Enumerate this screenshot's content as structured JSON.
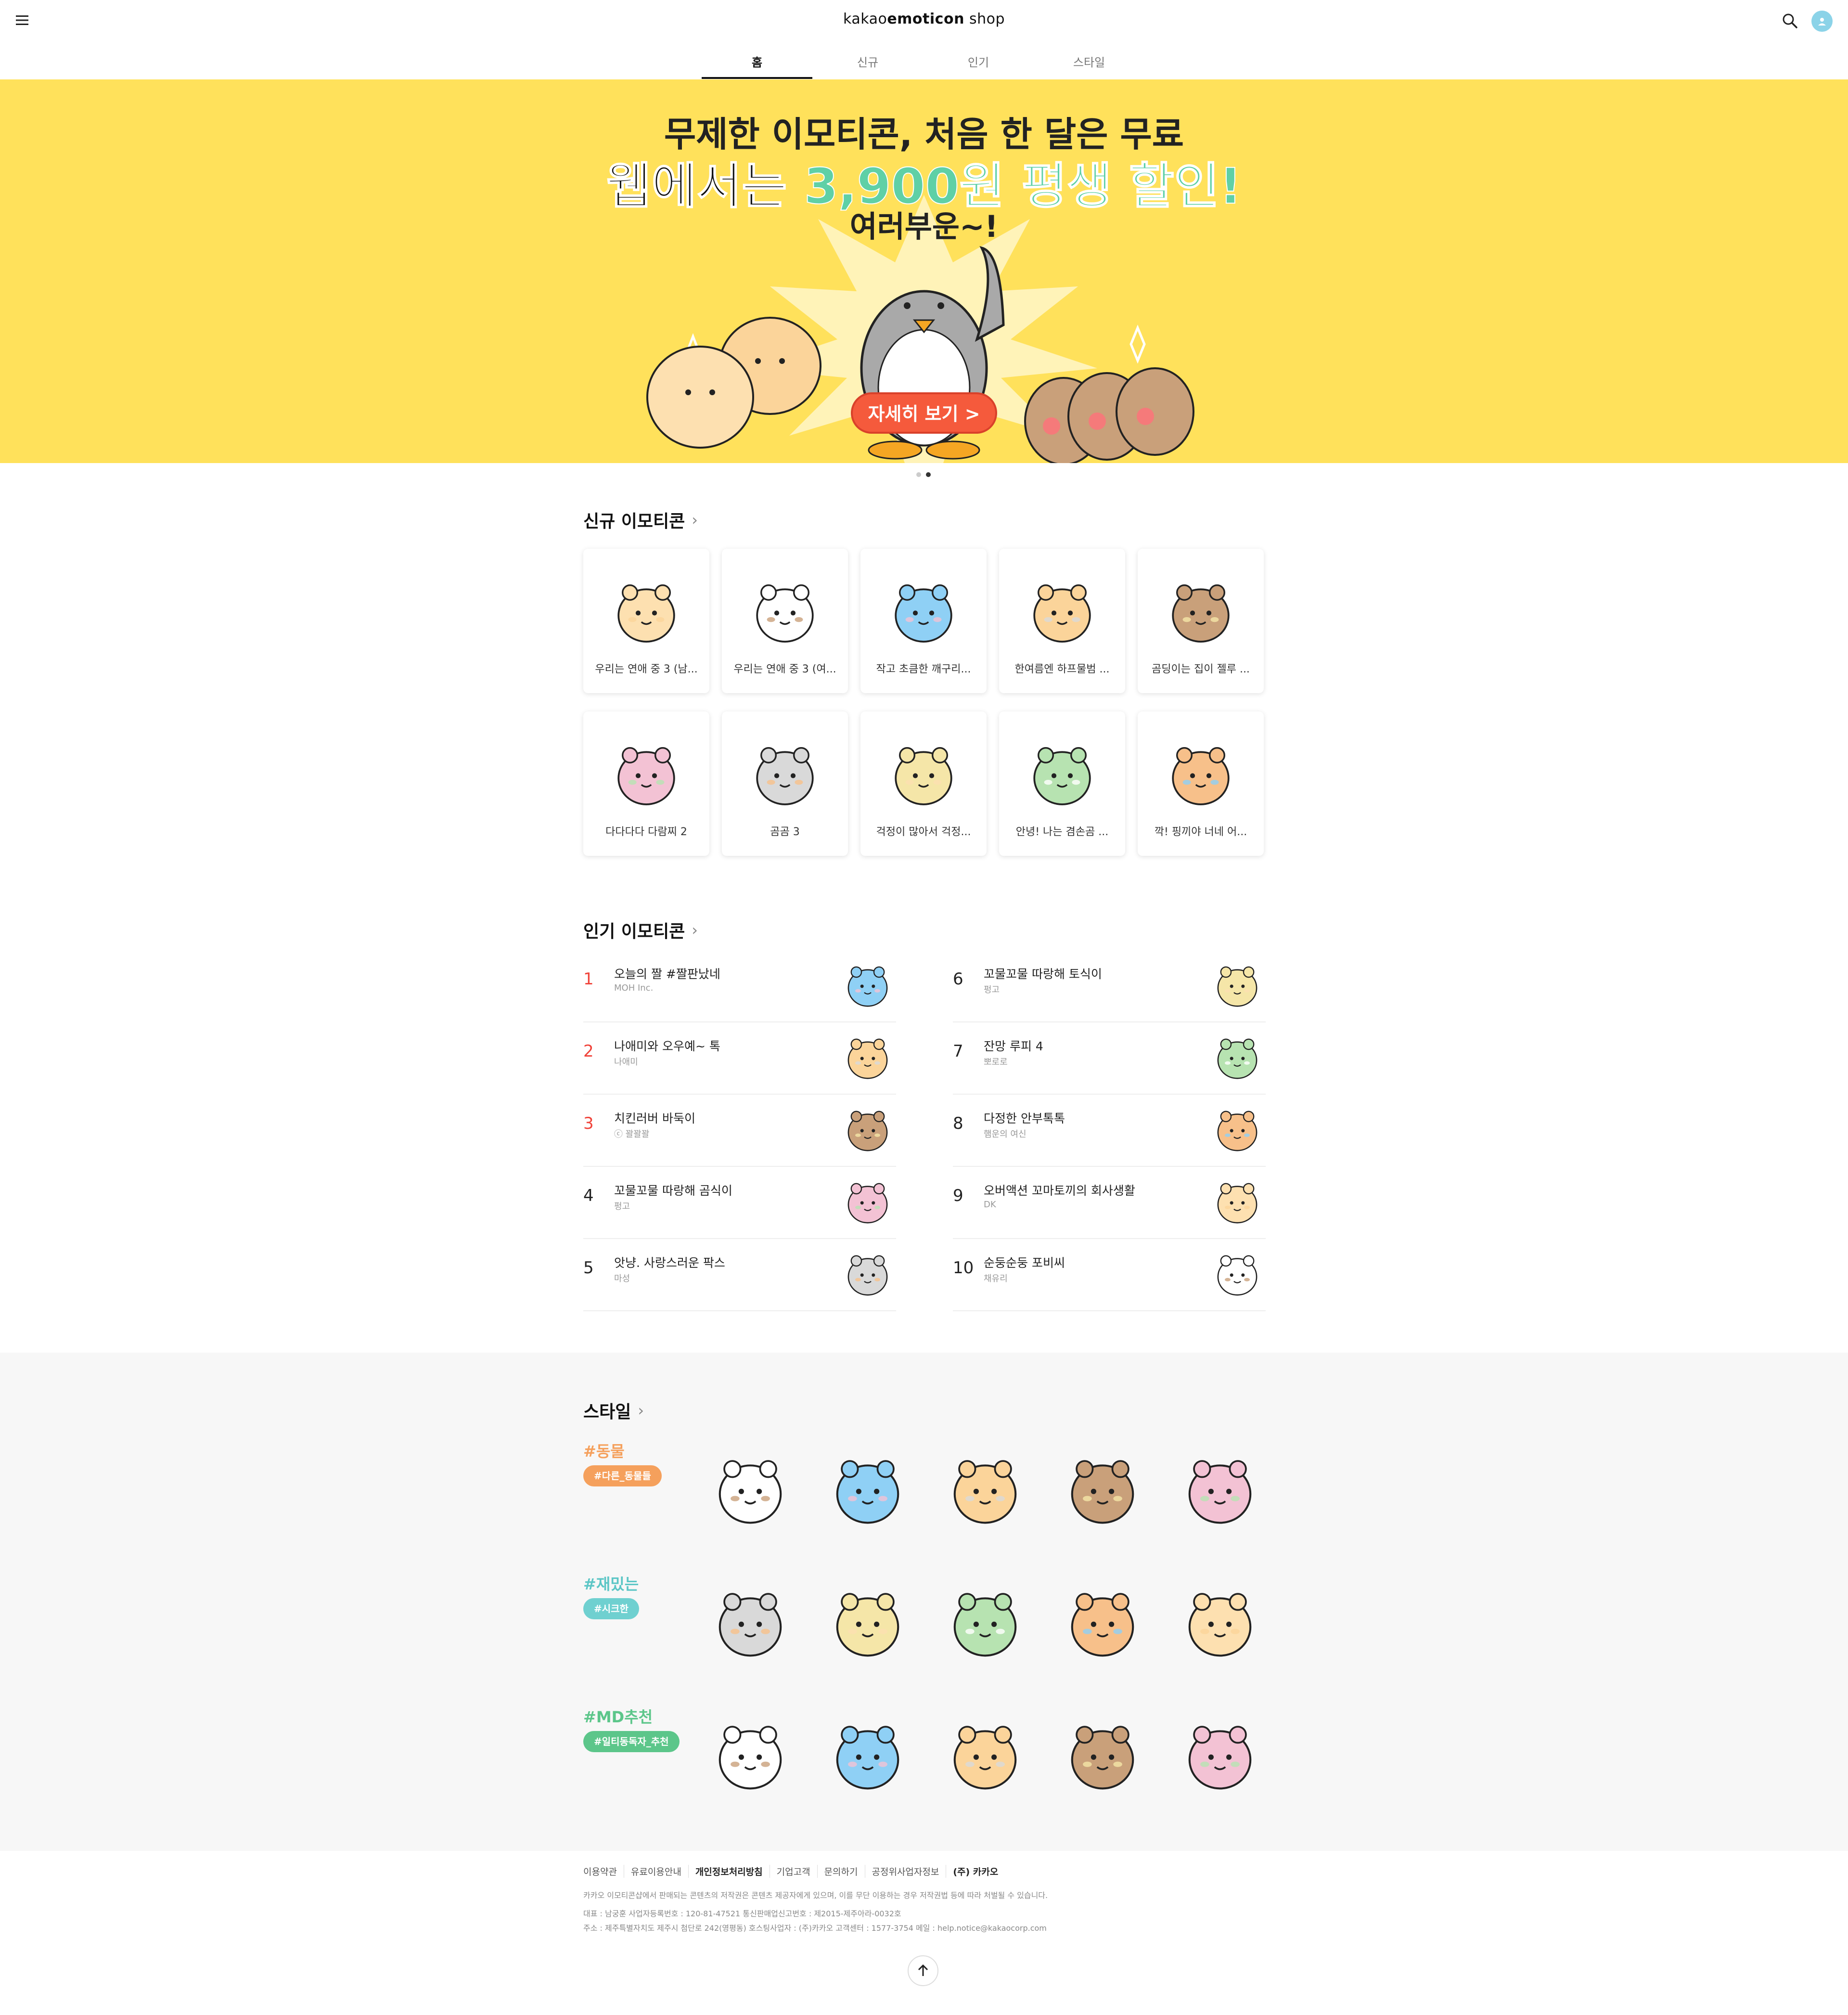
{
  "header": {
    "logo_prefix": "kakao",
    "logo_bold": "emoticon",
    "logo_suffix": " shop",
    "tabs": [
      {
        "label": "홈",
        "active": true
      },
      {
        "label": "신규",
        "active": false
      },
      {
        "label": "인기",
        "active": false
      },
      {
        "label": "스타일",
        "active": false
      }
    ]
  },
  "banner": {
    "line1": "무제한 이모티콘, 처음 한 달은 무료",
    "line2_a": "웹에서는 ",
    "line2_hl": "3,900원 평생 할인!",
    "line3": "여러부운~!",
    "button": "자세히 보기 >",
    "bg_color": "#ffe15b",
    "slide_count": 2,
    "active_slide": 2
  },
  "new_section": {
    "title": "신규 이모티콘",
    "items": [
      {
        "name": "우리는 연애 중 3 (남...",
        "icon": "couple-icon"
      },
      {
        "name": "우리는 연애 중 3 (여...",
        "icon": "couple-icon"
      },
      {
        "name": "작고 초큼한 깨구리...",
        "icon": "frog-icon"
      },
      {
        "name": "한여름엔 하프물범 ...",
        "icon": "seal-icon"
      },
      {
        "name": "곰딩이는 집이 젤루 ...",
        "icon": "bear-sleep-icon"
      },
      {
        "name": "다다다다 다람찌 2",
        "icon": "squirrel-icon"
      },
      {
        "name": "곰곰 3",
        "icon": "bear-icon"
      },
      {
        "name": "걱정이 많아서 걱정...",
        "icon": "worry-icon"
      },
      {
        "name": "안녕! 나는 겸손곰 ...",
        "icon": "humble-bear-icon"
      },
      {
        "name": "깍! 핑끼야 너네 어...",
        "icon": "wedding-icon"
      }
    ]
  },
  "popular_section": {
    "title": "인기 이모티콘",
    "items": [
      {
        "rank": "1",
        "title": "오늘의 짤 #짤판났네",
        "author": "MOH Inc."
      },
      {
        "rank": "2",
        "title": "나애미와 오우예~ 톡",
        "author": "나애미"
      },
      {
        "rank": "3",
        "title": "치킨러버 바둑이",
        "author": "ⓒ 꽐꽐꽐"
      },
      {
        "rank": "4",
        "title": "꼬물꼬물 따랑해 곰식이",
        "author": "펑고"
      },
      {
        "rank": "5",
        "title": "앗냥. 사랑스러운 팍스",
        "author": "마성"
      },
      {
        "rank": "6",
        "title": "꼬물꼬물 따랑해 토식이",
        "author": "펑고"
      },
      {
        "rank": "7",
        "title": "잔망 루피 4",
        "author": "뽀로로"
      },
      {
        "rank": "8",
        "title": "다정한 안부톡톡",
        "author": "햄운의 여신"
      },
      {
        "rank": "9",
        "title": "오버액션 꼬마토끼의 회사생활",
        "author": "DK"
      },
      {
        "rank": "10",
        "title": "순둥순둥 포비씨",
        "author": "채유리"
      }
    ]
  },
  "style_section": {
    "title": "스타일",
    "groups": [
      {
        "tag": "#동물",
        "pill": "#다른_동물들",
        "tag_color": "#f5a05c",
        "pill_color": "#f5a05c"
      },
      {
        "tag": "#재밌는",
        "pill": "#시크한",
        "tag_color": "#5cc6c6",
        "pill_color": "#6fd0d0"
      },
      {
        "tag": "#MD추천",
        "pill": "#일티동독자_추천",
        "tag_color": "#5cc68a",
        "pill_color": "#5cc68a"
      }
    ]
  },
  "footer": {
    "links": [
      "이용약관",
      "유료이용안내",
      "개인정보처리방침",
      "기업고객",
      "문의하기",
      "공정위사업자정보",
      "(주) 카카오"
    ],
    "notice": "카카오 이모티콘샵에서 판매되는 콘텐츠의 저작권은 콘텐츠 제공자에게 있으며, 이를 무단 이용하는 경우 저작권법 등에 따라 처벌될 수 있습니다.",
    "info1": "대표 : 남궁훈   사업자등록번호 : 120-81-47521   통신판매업신고번호 : 제2015-제주아라-0032호",
    "info2": "주소 : 제주특별자치도 제주시 첨단로 242(영평동)   호스팅사업자 : (주)카카오   고객센터 : 1577-3754   메일 : help.notice@kakaocorp.com"
  }
}
